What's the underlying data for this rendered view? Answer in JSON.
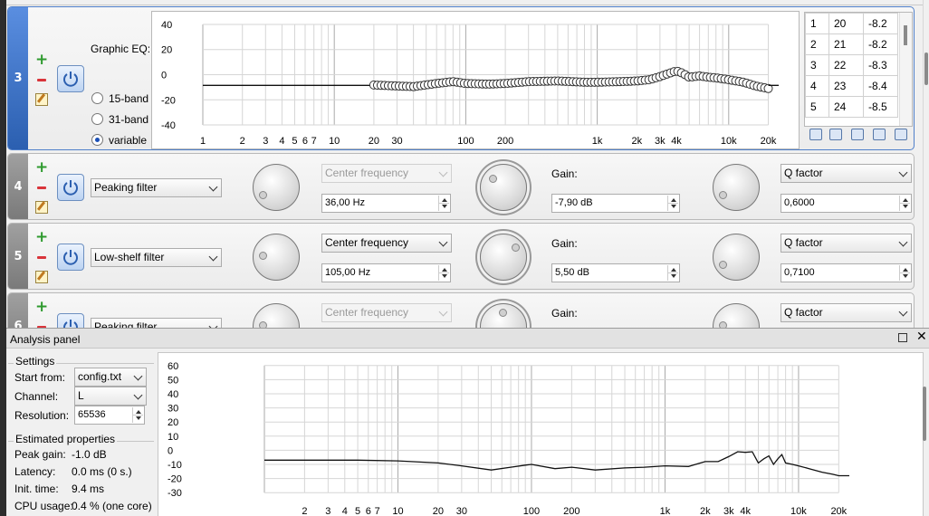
{
  "graphic_eq": {
    "index": "3",
    "title": "Graphic EQ:",
    "band_options": [
      "15-band",
      "31-band",
      "variable"
    ],
    "selected_band": "variable",
    "y_ticks": [
      "40",
      "20",
      "0",
      "-20",
      "-40"
    ],
    "x_ticks": [
      "1",
      "2",
      "3",
      "4",
      "5",
      "6",
      "7",
      "10",
      "20",
      "30",
      "100",
      "200",
      "1k",
      "2k",
      "3k",
      "4k",
      "10k",
      "20k"
    ],
    "table_rows": [
      {
        "n": "1",
        "f": "20",
        "g": "-8.2"
      },
      {
        "n": "2",
        "f": "21",
        "g": "-8.2"
      },
      {
        "n": "3",
        "f": "22",
        "g": "-8.3"
      },
      {
        "n": "4",
        "f": "23",
        "g": "-8.4"
      },
      {
        "n": "5",
        "f": "24",
        "g": "-8.5"
      }
    ],
    "toolbar_icons": [
      "save-icon",
      "import-icon",
      "invert-icon",
      "shift-up-icon",
      "shift-down-icon"
    ]
  },
  "filters": [
    {
      "index": "4",
      "type": "Peaking filter",
      "freq_label": "Center frequency",
      "freq_disabled": true,
      "freq": "36,00 Hz",
      "gain_label": "Gain:",
      "gain": "-7,90 dB",
      "q_label": "Q factor",
      "q": "0,6000"
    },
    {
      "index": "5",
      "type": "Low-shelf filter",
      "freq_label": "Center frequency",
      "freq_disabled": false,
      "freq": "105,00 Hz",
      "gain_label": "Gain:",
      "gain": "5,50 dB",
      "q_label": "Q factor",
      "q": "0,7100"
    },
    {
      "index": "6",
      "type": "Peaking filter",
      "freq_label": "Center frequency",
      "freq_disabled": true,
      "gain_label": "Gain:",
      "q_label": "Q factor"
    }
  ],
  "analysis": {
    "title": "Analysis panel",
    "settings_label": "Settings",
    "start_from_label": "Start from:",
    "start_from": "config.txt",
    "channel_label": "Channel:",
    "channel": "L",
    "resolution_label": "Resolution:",
    "resolution": "65536",
    "estimated_label": "Estimated properties",
    "peak_gain_label": "Peak gain:",
    "peak_gain": "-1.0 dB",
    "latency_label": "Latency:",
    "latency": "0.0 ms (0 s.)",
    "init_time_label": "Init. time:",
    "init_time": "9.4 ms",
    "cpu_label": "CPU usage:",
    "cpu": "0.4 % (one core)"
  },
  "chart_data": [
    {
      "type": "scatter",
      "title": "",
      "x_scale": "log",
      "xlim": [
        1,
        24000
      ],
      "ylim": [
        -45,
        45
      ],
      "y_ticks": [
        40,
        20,
        0,
        -20,
        -40
      ],
      "x_tick_labels": [
        "1",
        "2",
        "3",
        "4",
        "5",
        "6",
        "7",
        "10",
        "20",
        "30",
        "100",
        "200",
        "1k",
        "2k",
        "3k",
        "4k",
        "10k",
        "20k"
      ],
      "grid": true,
      "series": [
        {
          "values_x": [
            1,
            20
          ],
          "values_y": [
            -8.5,
            -8.5
          ],
          "style": "line"
        },
        {
          "values_x": [
            20,
            30,
            40,
            60,
            80,
            100,
            150,
            200,
            300,
            500,
            800,
            1000,
            1500,
            2000,
            2500,
            3000,
            3500,
            4000,
            4500,
            5000,
            6000,
            7000,
            8000,
            10000,
            13000,
            16000,
            20000
          ],
          "values_y": [
            -8.2,
            -9,
            -9.5,
            -7,
            -5.5,
            -7,
            -7.5,
            -7,
            -5.5,
            -5,
            -6,
            -6,
            -5.5,
            -5,
            -4,
            -1.5,
            1,
            3,
            1,
            -2,
            -1,
            -2,
            -2.5,
            -4,
            -6,
            -9,
            -11
          ],
          "style": "circles"
        },
        {
          "values_x": [
            20000,
            24000
          ],
          "values_y": [
            -8.5,
            -8.5
          ],
          "style": "line"
        }
      ]
    },
    {
      "type": "line",
      "title": "",
      "x_scale": "log",
      "xlim": [
        1,
        24000
      ],
      "ylim": [
        -35,
        65
      ],
      "y_ticks": [
        60,
        50,
        40,
        30,
        20,
        10,
        0,
        -10,
        -20,
        -30
      ],
      "x_tick_labels": [
        "2",
        "3",
        "4",
        "5",
        "6",
        "7",
        "10",
        "20",
        "30",
        "100",
        "200",
        "1k",
        "2k",
        "3k",
        "4k",
        "10k",
        "20k"
      ],
      "grid": true,
      "series": [
        {
          "values_x": [
            1,
            5,
            10,
            20,
            30,
            50,
            70,
            90,
            100,
            150,
            200,
            300,
            500,
            700,
            1000,
            1500,
            2000,
            2500,
            3000,
            3500,
            4000,
            4500,
            5000,
            5500,
            6000,
            6500,
            7000,
            7500,
            8000,
            9000,
            10000,
            12000,
            15000,
            18000,
            20000,
            24000
          ],
          "values_y": [
            -7,
            -7,
            -7.5,
            -9,
            -11,
            -14,
            -12,
            -10.5,
            -10,
            -13,
            -12,
            -14,
            -12.5,
            -12,
            -11,
            -11.5,
            -8,
            -8,
            -4.5,
            -1,
            -1.5,
            -1,
            -9,
            -6,
            -4,
            -10,
            -6,
            -3,
            -9,
            -10,
            -11,
            -13,
            -15.5,
            -17,
            -18,
            -18
          ]
        }
      ]
    }
  ]
}
